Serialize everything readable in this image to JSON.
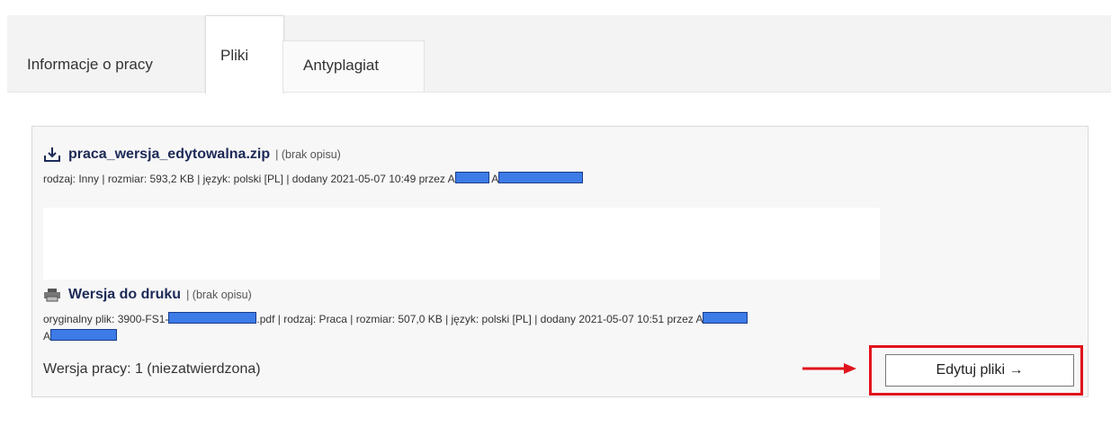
{
  "tabs": [
    {
      "label": "Informacje o pracy"
    },
    {
      "label": "Pliki"
    },
    {
      "label": "Antyplagiat"
    }
  ],
  "files": [
    {
      "icon": "download-icon",
      "name": "praca_wersja_edytowalna.zip",
      "desc": "| (brak opisu)",
      "meta": "rodzaj: Inny | rozmiar: 593,2 KB | język: polski [PL] | dodany 2021-05-07 10:49 przez A"
    },
    {
      "icon": "printer-icon",
      "name": "Wersja do druku",
      "desc": "| (brak opisu)",
      "meta_prefix": "oryginalny plik: 3900-FS1-",
      "meta_suffix": ".pdf | rodzaj: Praca | rozmiar: 507,0 KB | język: polski [PL] | dodany 2021-05-07 10:51 przez A",
      "meta_line2": "A"
    }
  ],
  "version_text": "Wersja pracy: 1 (niezatwierdzona)",
  "edit_button": "Edytuj pliki →",
  "colors": {
    "highlight": "#e1141c",
    "arrow": "#e1141c",
    "redaction": "#3d7be6"
  }
}
